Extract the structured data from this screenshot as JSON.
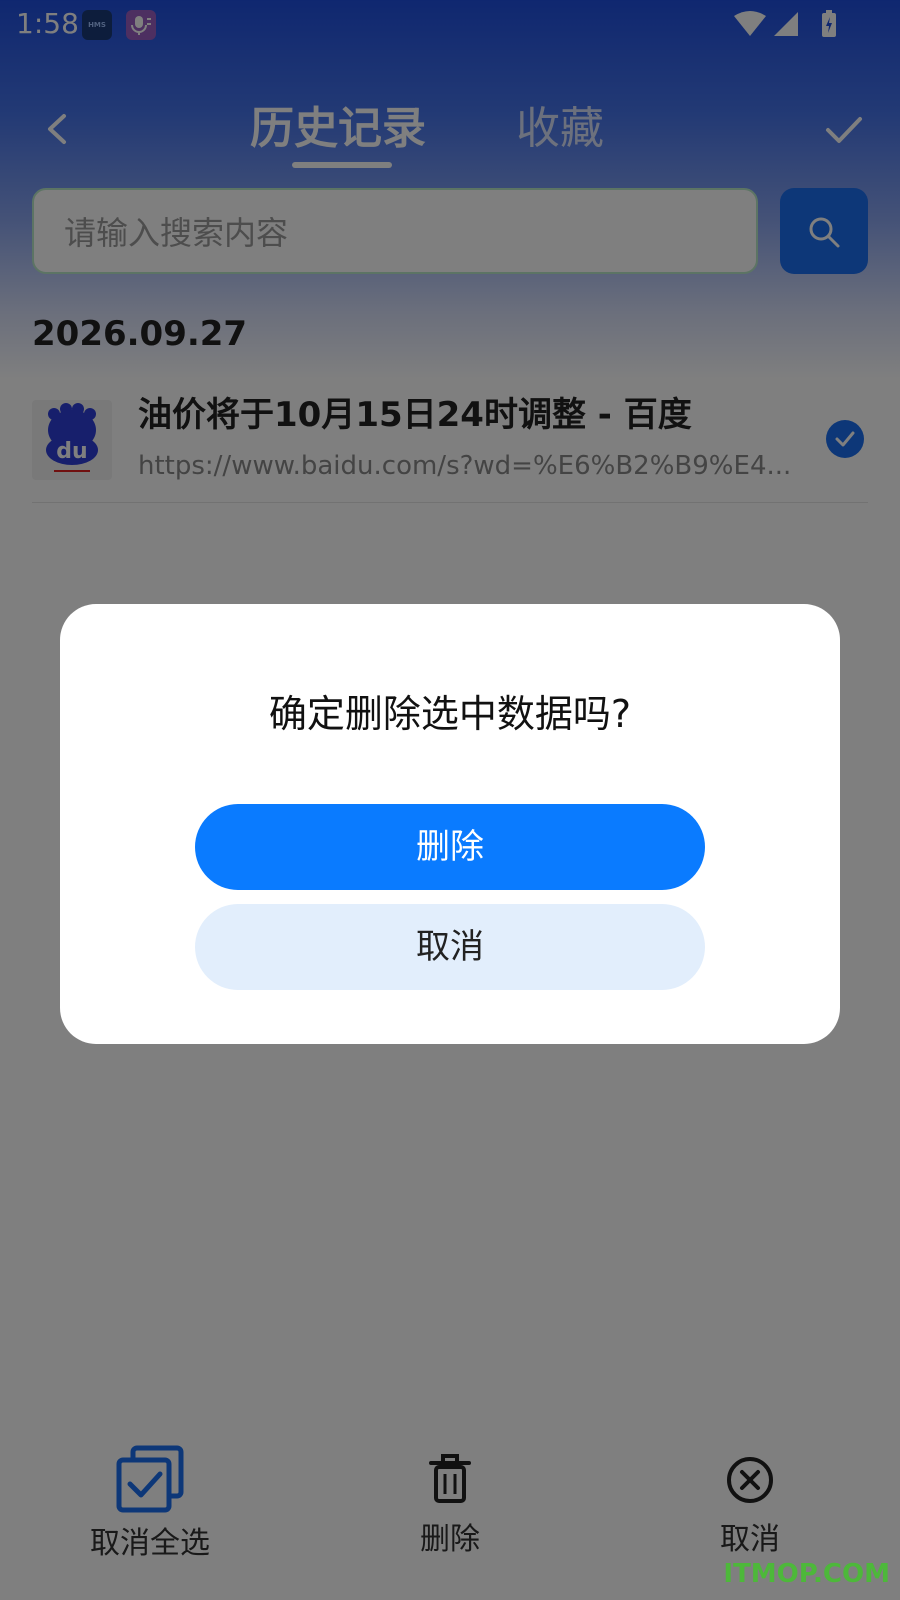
{
  "status_bar": {
    "time": "1:58",
    "hms_label": "HMS"
  },
  "header": {
    "tabs": [
      {
        "label": "历史记录",
        "active": true
      },
      {
        "label": "收藏",
        "active": false
      }
    ]
  },
  "search": {
    "placeholder": "请输入搜索内容",
    "value": ""
  },
  "history": {
    "groups": [
      {
        "date": "2026.09.27",
        "items": [
          {
            "title": "油价将于10月15日24时调整 - 百度",
            "url": "https://www.baidu.com/s?wd=%E6%B2%B9%E4...",
            "icon": "baidu-icon",
            "selected": true
          }
        ]
      }
    ]
  },
  "bottom_bar": {
    "select_all_label": "取消全选",
    "delete_label": "删除",
    "cancel_label": "取消"
  },
  "dialog": {
    "title": "确定删除选中数据吗?",
    "confirm_label": "删除",
    "cancel_label": "取消"
  },
  "watermark": "ITMOP.COM",
  "colors": {
    "accent": "#0a7bff",
    "header_top": "#1f4fe0",
    "cancel_button_bg": "#e2eefc",
    "overlay": "rgba(0,0,0,0.5)"
  }
}
